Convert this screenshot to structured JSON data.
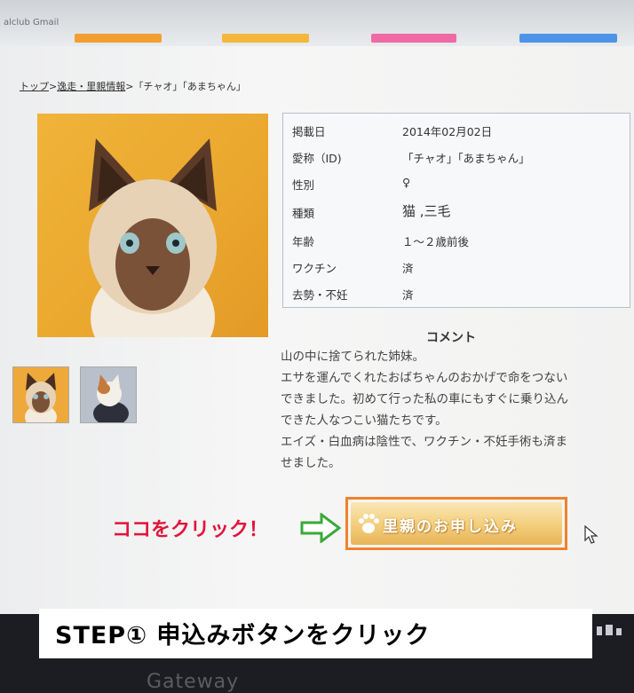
{
  "browser": {
    "tab_title": "alclub Gmail",
    "tab_colors": [
      "#f29e32",
      "#f4b73c",
      "#ef6aa5",
      "#4d94e8"
    ]
  },
  "breadcrumb": {
    "home": "トップ",
    "separator": ">",
    "section": "逸走・里親情報",
    "current": "「チャオ」「あまちゃん」"
  },
  "info": {
    "rows": [
      {
        "label": "掲載日",
        "value": "2014年02月02日"
      },
      {
        "label": "愛称（ID)",
        "value": "「チャオ」「あまちゃん」"
      },
      {
        "label": "性別",
        "value": "♀"
      },
      {
        "label": "種類",
        "value": "猫 ,三毛"
      },
      {
        "label": "年齢",
        "value": "１～２歳前後"
      },
      {
        "label": "ワクチン",
        "value": "済"
      },
      {
        "label": "去勢・不妊",
        "value": "済"
      }
    ]
  },
  "comment": {
    "title": "コメント",
    "lines": [
      "山の中に捨てられた姉妹。",
      "エサを運んでくれたおばちゃんのおかげで命をつない",
      "できました。初めて行った私の車にもすぐに乗り込ん",
      "できた人なつこい猫たちです。",
      "エイズ・白血病は陰性で、ワクチン・不妊手術も済ま",
      "せました。"
    ]
  },
  "annotation": {
    "click_here": "ココをクリック！",
    "step": "STEP① 申込みボタンをクリック"
  },
  "apply_button": {
    "label": "里親のお申し込み"
  },
  "monitor": {
    "brand": "Gateway"
  },
  "colors": {
    "highlight_frame": "#f0822c",
    "click_text": "#e2143a",
    "arrow": "#3aaa3a"
  }
}
